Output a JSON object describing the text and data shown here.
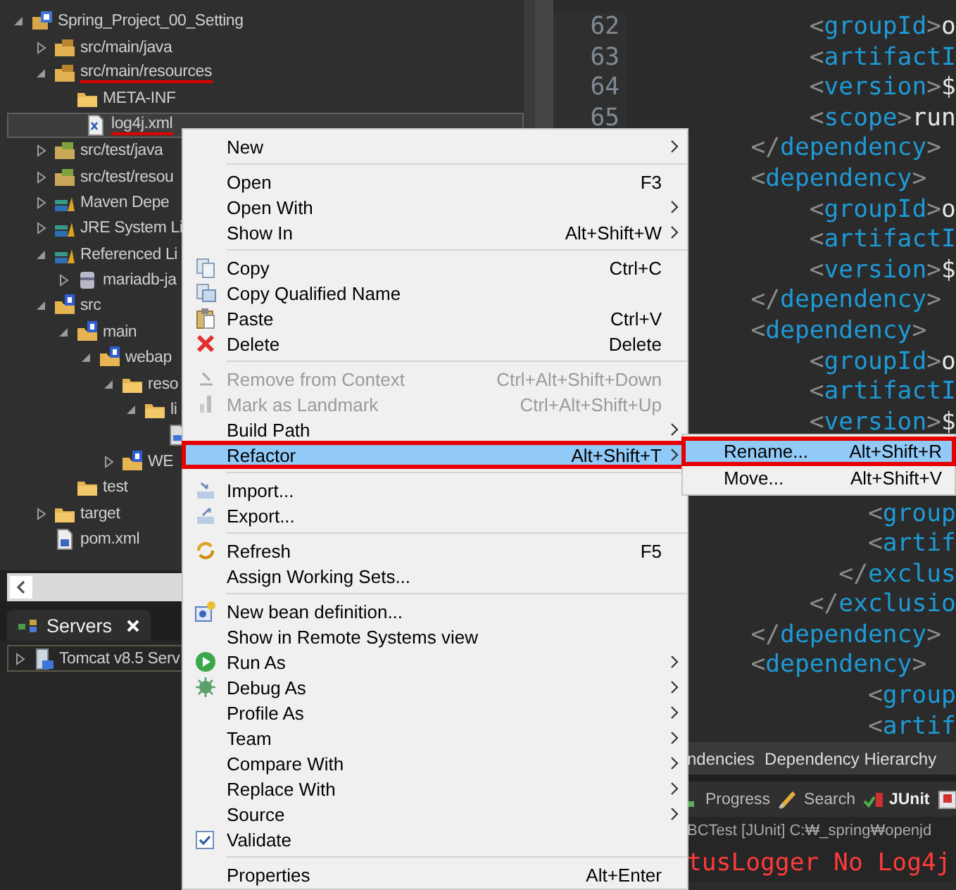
{
  "package_explorer": {
    "tree": [
      {
        "label": "Spring_Project_00_Setting",
        "kind": "project",
        "expanded": true,
        "selected": false,
        "children": [
          {
            "label": "src/main/java",
            "kind": "package-folder",
            "expanded": false,
            "selected": false
          },
          {
            "label": "src/main/resources",
            "kind": "package-folder",
            "expanded": true,
            "selected": false,
            "marked": true,
            "children": [
              {
                "label": "META-INF",
                "kind": "folder",
                "selected": false
              },
              {
                "label": "log4j.xml",
                "kind": "xml-file",
                "selected": true,
                "marked": true
              }
            ]
          },
          {
            "label": "src/test/java",
            "kind": "test-folder",
            "expanded": false,
            "selected": false
          },
          {
            "label": "src/test/resou",
            "kind": "test-folder",
            "expanded": false,
            "selected": false
          },
          {
            "label": "Maven Depe",
            "kind": "library",
            "expanded": false,
            "selected": false
          },
          {
            "label": "JRE System Li",
            "kind": "library",
            "expanded": false,
            "selected": false
          },
          {
            "label": "Referenced Li",
            "kind": "library",
            "expanded": true,
            "selected": false,
            "children": [
              {
                "label": "mariadb-ja",
                "kind": "jar",
                "expanded": false,
                "selected": false
              }
            ]
          },
          {
            "label": "src",
            "kind": "web-folder",
            "expanded": true,
            "selected": false,
            "children": [
              {
                "label": "main",
                "kind": "web-folder",
                "expanded": true,
                "selected": false,
                "children": [
                  {
                    "label": "webap",
                    "kind": "web-folder",
                    "expanded": true,
                    "selected": false,
                    "children": [
                      {
                        "label": "reso",
                        "kind": "folder",
                        "expanded": true,
                        "selected": false,
                        "children": [
                          {
                            "label": "li",
                            "kind": "folder",
                            "expanded": true,
                            "selected": false,
                            "children": [
                              {
                                "kind": "file",
                                "selected": false
                              }
                            ]
                          }
                        ]
                      },
                      {
                        "label": "WE",
                        "kind": "web-folder",
                        "expanded": false,
                        "selected": false
                      }
                    ]
                  }
                ]
              },
              {
                "label": "test",
                "kind": "folder",
                "selected": false
              }
            ]
          },
          {
            "label": "target",
            "kind": "folder",
            "expanded": false,
            "selected": false
          },
          {
            "label": "pom.xml",
            "kind": "maven-file",
            "selected": false
          }
        ]
      }
    ]
  },
  "servers_view": {
    "tab": {
      "label": "Servers",
      "selected": true
    },
    "items": [
      {
        "label": "Tomcat v8.5 Serv",
        "expanded": false,
        "selected": true
      }
    ]
  },
  "editor": {
    "blocks": [
      {
        "lines": [
          {
            "number": "62",
            "text": "            <groupId>o"
          },
          {
            "number": "63",
            "text": "            <artifactI"
          },
          {
            "number": "64",
            "text": "            <version>$"
          },
          {
            "number": "65",
            "text": "            <scope>run"
          },
          {
            "text": "        </dependency>"
          },
          {
            "text": "        <dependency>"
          },
          {
            "text": "            <groupId>o"
          },
          {
            "text": "            <artifactI"
          },
          {
            "text": "            <version>$"
          },
          {
            "text": "        </dependency>"
          },
          {
            "text": "        <dependency>"
          },
          {
            "text": "            <groupId>o"
          },
          {
            "text": "            <artifactI"
          },
          {
            "text": "            <version>$"
          }
        ]
      },
      {
        "lines": [
          {
            "text": "                <group"
          },
          {
            "text": "                <artif"
          },
          {
            "text": "              </exclus"
          },
          {
            "text": "            </exclusio"
          },
          {
            "text": "        </dependency>"
          },
          {
            "text": "        <dependency>"
          },
          {
            "text": "                <group"
          },
          {
            "text": "                <artif"
          }
        ]
      }
    ]
  },
  "editor_tabs": [
    {
      "label": "ndencies",
      "selected": false
    },
    {
      "label": "Dependency Hierarchy",
      "selected": false
    }
  ],
  "bottom_views": [
    {
      "label": "Progress",
      "kind": "progress",
      "selected": false
    },
    {
      "label": "Search",
      "kind": "search",
      "selected": false
    },
    {
      "label": "JUnit",
      "kind": "junit",
      "selected": true
    },
    {
      "kind": "task",
      "selected": false
    }
  ],
  "console": {
    "launch": "BCTest [JUnit] C:₩_spring₩openjd",
    "output": [
      "tusLogger No Log4j"
    ]
  },
  "context_menu": {
    "groups": [
      {
        "items": [
          {
            "kind": "plain",
            "label": "New",
            "submenu": true,
            "disabled": false,
            "selected": false
          }
        ]
      },
      {
        "items": [
          {
            "kind": "plain",
            "label": "Open",
            "shortcut": "F3",
            "disabled": false,
            "selected": false
          },
          {
            "kind": "plain",
            "label": "Open With",
            "submenu": true,
            "disabled": false,
            "selected": false
          },
          {
            "kind": "plain",
            "label": "Show In",
            "shortcut": "Alt+Shift+W",
            "submenu": true,
            "disabled": false,
            "selected": false
          }
        ]
      },
      {
        "items": [
          {
            "kind": "copy",
            "label": "Copy",
            "shortcut": "Ctrl+C",
            "disabled": false,
            "selected": false
          },
          {
            "kind": "copy-name",
            "label": "Copy Qualified Name",
            "disabled": false,
            "selected": false
          },
          {
            "kind": "paste",
            "label": "Paste",
            "shortcut": "Ctrl+V",
            "disabled": false,
            "selected": false
          },
          {
            "kind": "delete",
            "label": "Delete",
            "shortcut": "Delete",
            "disabled": false,
            "selected": false
          }
        ]
      },
      {
        "items": [
          {
            "kind": "remove-context",
            "label": "Remove from Context",
            "shortcut": "Ctrl+Alt+Shift+Down",
            "disabled": true,
            "selected": false
          },
          {
            "kind": "landmark",
            "label": "Mark as Landmark",
            "shortcut": "Ctrl+Alt+Shift+Up",
            "disabled": true,
            "selected": false
          },
          {
            "kind": "plain",
            "label": "Build Path",
            "submenu": true,
            "disabled": false,
            "selected": false
          },
          {
            "kind": "plain",
            "label": "Refactor",
            "shortcut": "Alt+Shift+T",
            "submenu": true,
            "disabled": false,
            "selected": true,
            "marked": true
          }
        ]
      },
      {
        "items": [
          {
            "kind": "import",
            "label": "Import...",
            "disabled": false,
            "selected": false
          },
          {
            "kind": "export",
            "label": "Export...",
            "disabled": false,
            "selected": false
          }
        ]
      },
      {
        "items": [
          {
            "kind": "refresh",
            "label": "Refresh",
            "shortcut": "F5",
            "disabled": false,
            "selected": false
          },
          {
            "kind": "plain",
            "label": "Assign Working Sets...",
            "disabled": false,
            "selected": false
          }
        ]
      },
      {
        "items": [
          {
            "kind": "bean",
            "label": "New bean definition...",
            "disabled": false,
            "selected": false
          },
          {
            "kind": "plain",
            "label": "Show in Remote Systems view",
            "disabled": false,
            "selected": false
          },
          {
            "kind": "run",
            "label": "Run As",
            "submenu": true,
            "disabled": false,
            "selected": false
          },
          {
            "kind": "debug",
            "label": "Debug As",
            "submenu": true,
            "disabled": false,
            "selected": false
          },
          {
            "kind": "plain",
            "label": "Profile As",
            "submenu": true,
            "disabled": false,
            "selected": false
          },
          {
            "kind": "plain",
            "label": "Team",
            "submenu": true,
            "disabled": false,
            "selected": false
          },
          {
            "kind": "plain",
            "label": "Compare With",
            "submenu": true,
            "disabled": false,
            "selected": false
          },
          {
            "kind": "plain",
            "label": "Replace With",
            "submenu": true,
            "disabled": false,
            "selected": false
          },
          {
            "kind": "plain",
            "label": "Source",
            "submenu": true,
            "disabled": false,
            "selected": false
          },
          {
            "kind": "check",
            "label": "Validate",
            "checked": true,
            "disabled": false,
            "selected": false
          }
        ]
      },
      {
        "items": [
          {
            "kind": "plain",
            "label": "Properties",
            "shortcut": "Alt+Enter",
            "disabled": false,
            "selected": false
          }
        ]
      }
    ]
  },
  "refactor_submenu": {
    "items": [
      {
        "label": "Rename...",
        "shortcut": "Alt+Shift+R",
        "selected": true,
        "marked": true
      },
      {
        "label": "Move...",
        "shortcut": "Alt+Shift+V",
        "selected": false
      }
    ]
  }
}
